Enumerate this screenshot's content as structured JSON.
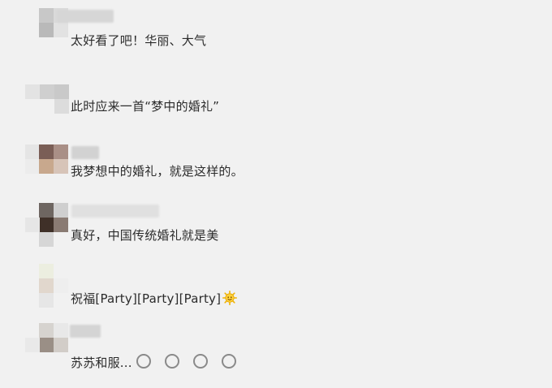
{
  "comments": [
    {
      "text": "太好看了吧！华丽、大气"
    },
    {
      "text": "此时应来一首“梦中的婚礼”"
    },
    {
      "text": "我梦想中的婚礼，就是这样的。"
    },
    {
      "text": "真好，中国传统婚礼就是美"
    },
    {
      "text": "祝福[Party][Party][Party]",
      "emoji": "smiling-sun-emoji"
    },
    {
      "text": "苏苏和服...",
      "emoji": "face-emoji"
    }
  ]
}
